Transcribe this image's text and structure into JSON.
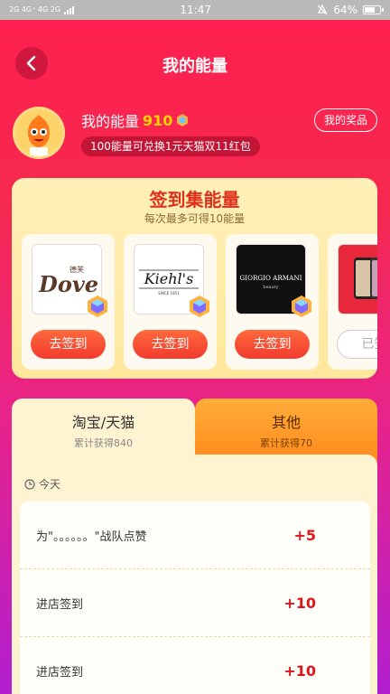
{
  "status_bar": {
    "left": "2G 4G⁺ 4G 2G",
    "time": "11:47",
    "battery": "64%"
  },
  "nav": {
    "title": "我的能量"
  },
  "profile": {
    "energy_label": "我的能量",
    "energy_value": "910",
    "exchange_text": "100能量可兑换1元天猫双11红包",
    "rewards_button": "我的奖品"
  },
  "signin": {
    "title": "签到集能量",
    "subtitle": "每次最多可得10能量",
    "brands": [
      {
        "name": "Dove",
        "cn": "德芙",
        "button": "去签到"
      },
      {
        "name": "Kiehl's",
        "tag": "SINCE 1851",
        "button": "去签到"
      },
      {
        "name": "GIORGIO ARMANI",
        "sub": "beauty",
        "button": "去签到"
      },
      {
        "name": "iPhone",
        "button": "已签"
      }
    ]
  },
  "tabs": [
    {
      "label": "淘宝/天猫",
      "sub": "累计获得840"
    },
    {
      "label": "其他",
      "sub": "累计获得70"
    }
  ],
  "records": {
    "date_label": "今天",
    "items": [
      {
        "label": "为\"。。。。。。\"战队点赞",
        "points": "+5"
      },
      {
        "label": "进店签到",
        "points": "+10"
      },
      {
        "label": "进店签到",
        "points": "+10"
      }
    ]
  },
  "colors": {
    "brand_red": "#ff1f4f",
    "gold": "#ffd400",
    "accent_orange": "#ff8a1c",
    "points_red": "#e0151b"
  }
}
